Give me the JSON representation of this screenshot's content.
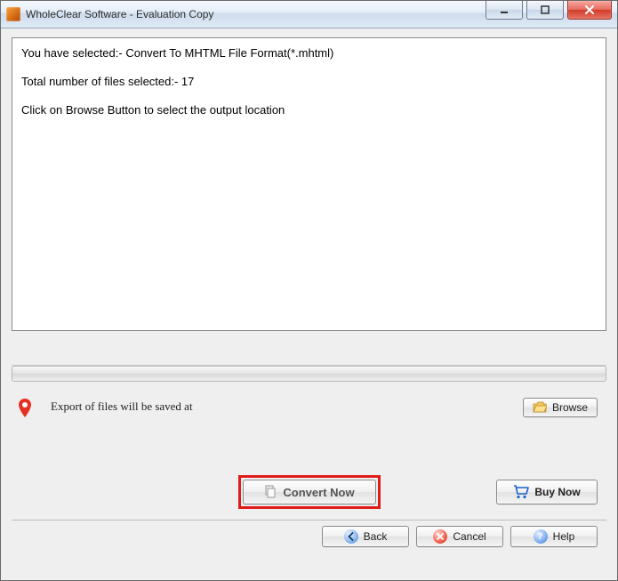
{
  "window": {
    "title": "WholeClear Software - Evaluation Copy"
  },
  "info": {
    "line1": "You have selected:- Convert To MHTML File Format(*.mhtml)",
    "line2": "Total number of files selected:- 17",
    "line3": "Click on Browse Button to select the output location"
  },
  "export": {
    "label": "Export of files will be saved at",
    "browse_label": "Browse"
  },
  "actions": {
    "convert_label": "Convert Now",
    "buy_label": "Buy Now"
  },
  "nav": {
    "back_label": "Back",
    "cancel_label": "Cancel",
    "help_label": "Help"
  }
}
